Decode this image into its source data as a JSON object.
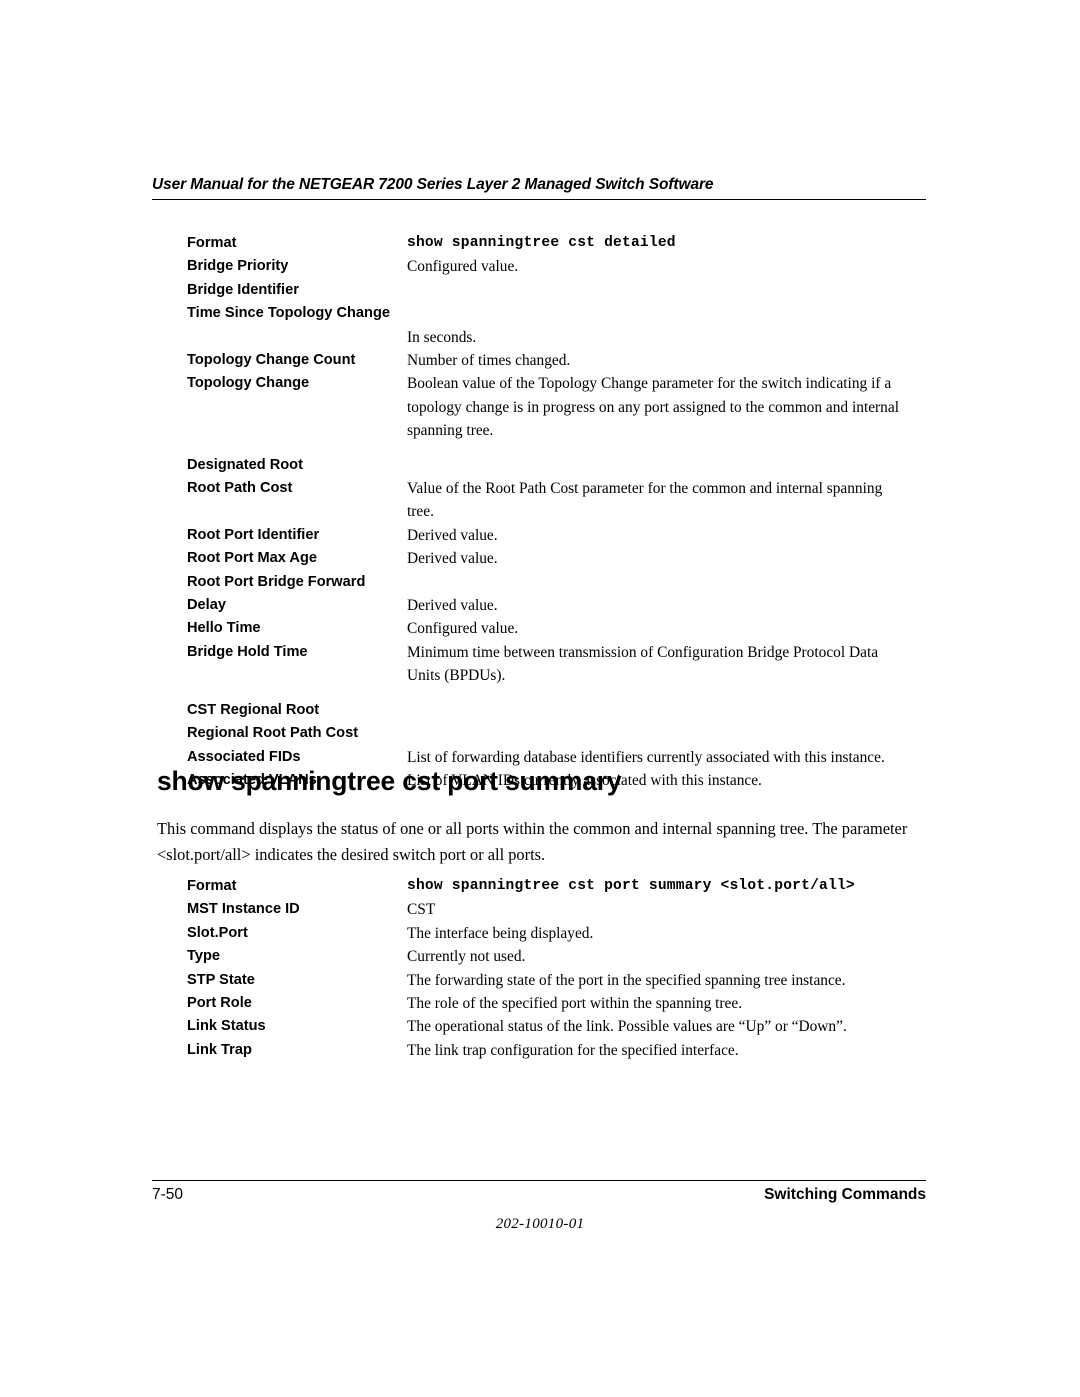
{
  "running_head": "User Manual for the NETGEAR 7200 Series Layer 2 Managed Switch Software",
  "table_one": {
    "rows": [
      {
        "term": "Format",
        "desc": "show spanningtree cst detailed",
        "mono": true
      },
      {
        "term": "Bridge Priority",
        "desc": "Configured value."
      },
      {
        "term": "Bridge Identifier",
        "desc": ""
      },
      {
        "term": "Time Since Topology Change",
        "desc": "In seconds.",
        "term_wraps": true
      },
      {
        "term": "Topology Change Count",
        "desc": "Number of times changed."
      },
      {
        "term": "Topology Change",
        "desc": "Boolean value of the Topology Change parameter for the switch indicating if a topology change is in progress on any port assigned to the common and internal spanning tree."
      },
      {
        "term": "Designated Root",
        "desc": "",
        "gap_before": true
      },
      {
        "term": "Root Path Cost",
        "desc": "Value of the Root Path Cost parameter for the common and internal spanning tree."
      },
      {
        "term": "Root Port Identifier",
        "desc": "Derived value."
      },
      {
        "term": "Root Port Max Age",
        "desc": "Derived value."
      },
      {
        "term": "Root Port Bridge Forward Delay",
        "desc": "Derived value.",
        "term_wraps": true
      },
      {
        "term": "Hello Time",
        "desc": "Configured value."
      },
      {
        "term": "Bridge Hold Time",
        "desc": "Minimum time between transmission of Configuration Bridge Protocol Data Units (BPDUs)."
      },
      {
        "term": "CST Regional Root",
        "desc": "",
        "gap_before": true
      },
      {
        "term": "Regional Root Path Cost",
        "desc": ""
      },
      {
        "term": "Associated FIDs",
        "desc": "List of forwarding database identifiers currently associated with this instance."
      },
      {
        "term": "Associated VLANs",
        "desc": "List of VLAN IDs currently associated with this instance."
      }
    ]
  },
  "section": {
    "heading": "show spanningtree cst port summary",
    "paragraph": "This command displays the status of one or all ports within the common and internal spanning tree. The parameter <slot.port/all> indicates the desired switch port or all ports."
  },
  "table_two": {
    "rows": [
      {
        "term": "Format",
        "desc": "show spanningtree cst port summary <slot.port/all>",
        "mono": true
      },
      {
        "term": "MST Instance ID",
        "desc": "CST"
      },
      {
        "term": "Slot.Port",
        "desc": "The interface being displayed."
      },
      {
        "term": "Type",
        "desc": "Currently not used."
      },
      {
        "term": "STP State",
        "desc": "The forwarding state of the port in the specified spanning tree instance."
      },
      {
        "term": "Port Role",
        "desc": "The role of the specified port within the spanning tree."
      },
      {
        "term": "Link Status",
        "desc": "The operational status of the link. Possible values are “Up” or “Down”."
      },
      {
        "term": "Link Trap",
        "desc": "The link trap configuration for the specified interface."
      }
    ]
  },
  "footer": {
    "page_number": "7-50",
    "chapter": "Switching Commands",
    "document_number": "202-10010-01"
  }
}
